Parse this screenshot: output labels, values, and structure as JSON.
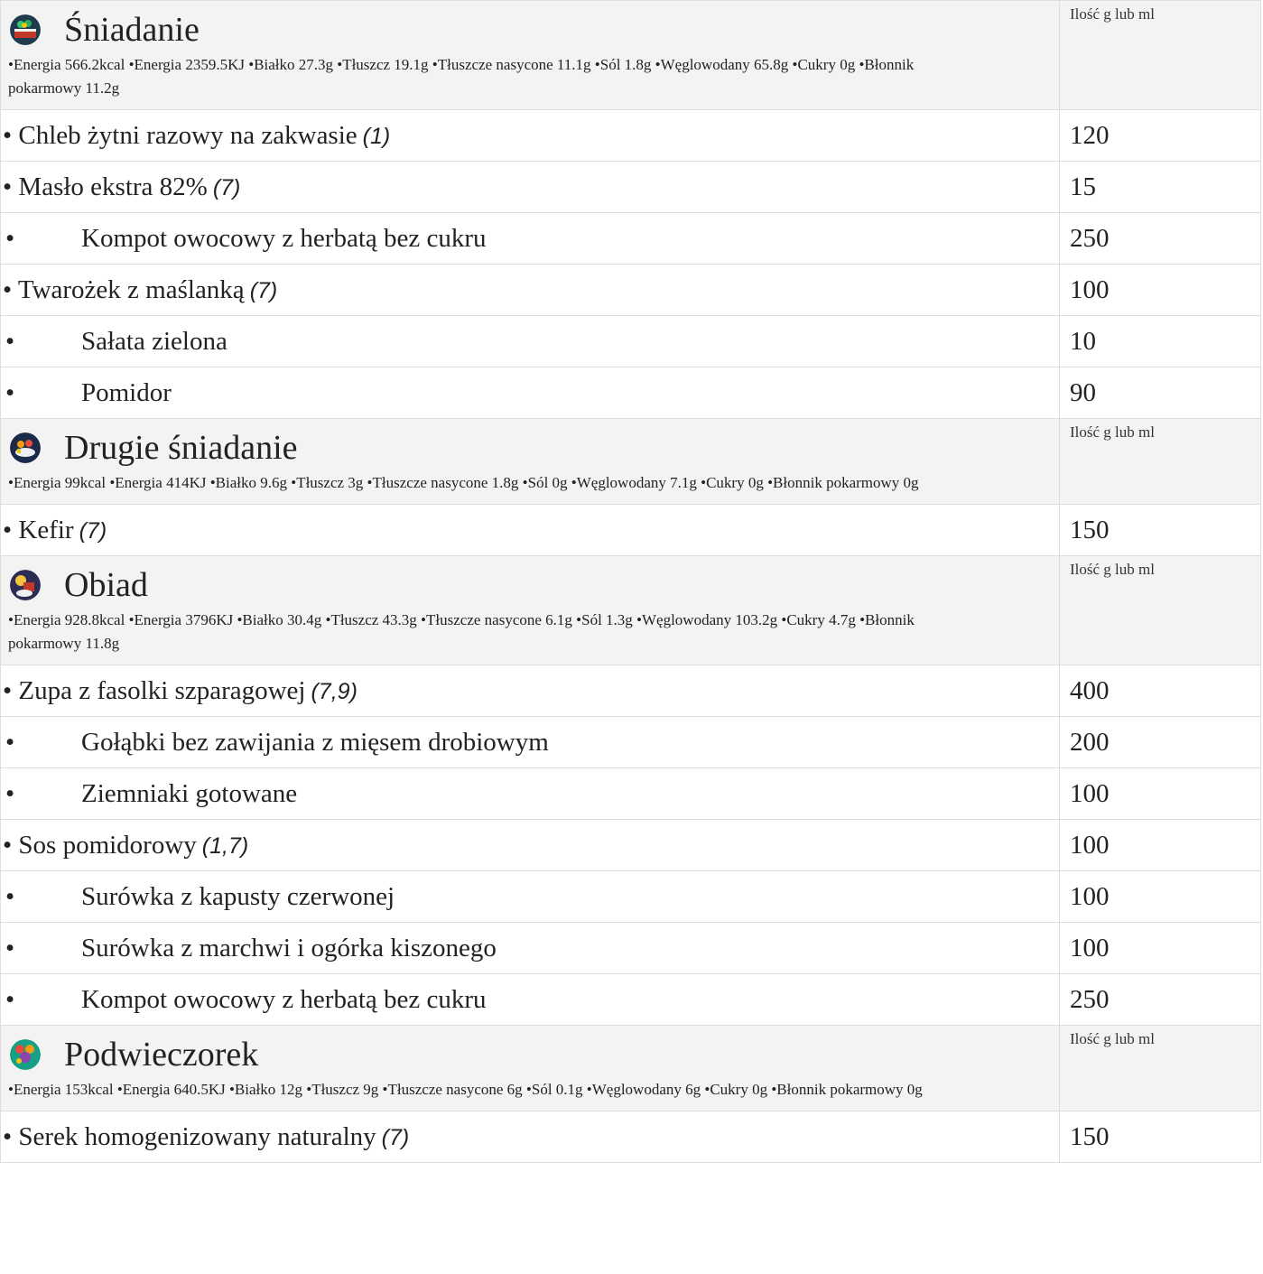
{
  "quantity_header": "Ilość g lub ml",
  "meals": [
    {
      "name": "Śniadanie",
      "icon": "breakfast-icon",
      "nutrition": "•Energia 566.2kcal •Energia 2359.5KJ •Białko 27.3g •Tłuszcz 19.1g •Tłuszcze nasycone 11.1g •Sól 1.8g •Węglowodany 65.8g •Cukry 0g •Błonnik pokarmowy 11.2g",
      "items": [
        {
          "name": "Chleb żytni razowy na zakwasie",
          "allergens": "(1)",
          "qty": "120"
        },
        {
          "name": "Masło ekstra 82%",
          "allergens": "(7)",
          "qty": "15"
        },
        {
          "name": "Kompot owocowy z herbatą bez cukru",
          "allergens": "",
          "qty": "250"
        },
        {
          "name": "Twarożek z maślanką",
          "allergens": "(7)",
          "qty": "100"
        },
        {
          "name": "Sałata zielona",
          "allergens": "",
          "qty": "10"
        },
        {
          "name": "Pomidor",
          "allergens": "",
          "qty": "90"
        }
      ]
    },
    {
      "name": "Drugie śniadanie",
      "icon": "second-breakfast-icon",
      "nutrition": "•Energia 99kcal •Energia 414KJ •Białko 9.6g •Tłuszcz 3g •Tłuszcze nasycone 1.8g •Sól 0g •Węglowodany 7.1g •Cukry 0g •Błonnik pokarmowy 0g",
      "items": [
        {
          "name": "Kefir",
          "allergens": "(7)",
          "qty": "150"
        }
      ]
    },
    {
      "name": "Obiad",
      "icon": "lunch-icon",
      "nutrition": "•Energia 928.8kcal •Energia 3796KJ •Białko 30.4g •Tłuszcz 43.3g •Tłuszcze nasycone 6.1g •Sól 1.3g •Węglowodany 103.2g •Cukry 4.7g •Błonnik pokarmowy 11.8g",
      "items": [
        {
          "name": "Zupa z fasolki szparagowej",
          "allergens": "(7,9)",
          "qty": "400"
        },
        {
          "name": "Gołąbki bez zawijania z mięsem drobiowym",
          "allergens": "",
          "qty": "200"
        },
        {
          "name": "Ziemniaki gotowane",
          "allergens": "",
          "qty": "100"
        },
        {
          "name": "Sos pomidorowy",
          "allergens": "(1,7)",
          "qty": "100"
        },
        {
          "name": "Surówka z kapusty czerwonej",
          "allergens": "",
          "qty": "100"
        },
        {
          "name": "Surówka z marchwi i ogórka kiszonego",
          "allergens": "",
          "qty": "100"
        },
        {
          "name": "Kompot owocowy z herbatą bez cukru",
          "allergens": "",
          "qty": "250"
        }
      ]
    },
    {
      "name": "Podwieczorek",
      "icon": "afternoon-snack-icon",
      "nutrition": "•Energia 153kcal •Energia 640.5KJ •Białko 12g •Tłuszcz 9g •Tłuszcze nasycone 6g •Sól 0.1g •Węglowodany 6g •Cukry 0g •Błonnik pokarmowy 0g",
      "items": [
        {
          "name": "Serek homogenizowany naturalny",
          "allergens": "(7)",
          "qty": "150"
        }
      ]
    }
  ]
}
